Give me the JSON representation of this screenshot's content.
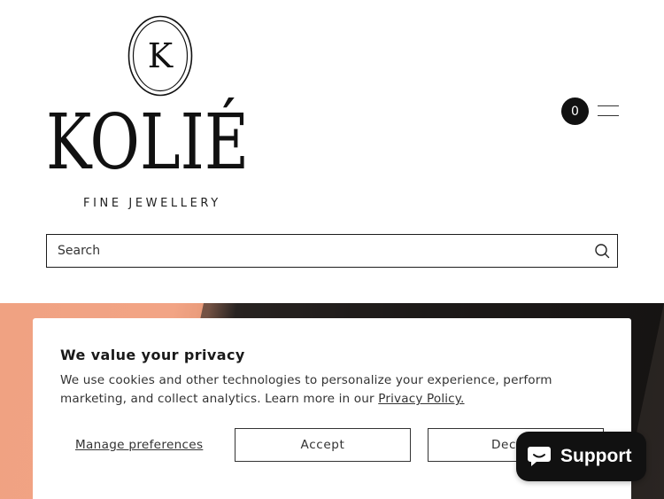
{
  "header": {
    "logo_letter": "K",
    "brand_name": "KOLIÉ",
    "brand_tagline": "FINE JEWELLERY",
    "cart_count": "0",
    "menu_icon": "hamburger-menu-icon"
  },
  "search": {
    "placeholder": "Search",
    "icon": "search-icon"
  },
  "cookie_banner": {
    "title": "We value your privacy",
    "body_text": "We use cookies and other technologies to personalize your experience, perform marketing, and collect analytics. Learn more in our ",
    "policy_link": "Privacy Policy.",
    "manage_label": "Manage preferences",
    "accept_label": "Accept",
    "decline_label": "Decline"
  },
  "support_widget": {
    "label": "Support",
    "icon": "chat-bubble-icon"
  },
  "colors": {
    "primary_dark": "#111111",
    "hero_peach": "#f0a282",
    "hero_dark": "#1d1a19",
    "background": "#ffffff"
  }
}
